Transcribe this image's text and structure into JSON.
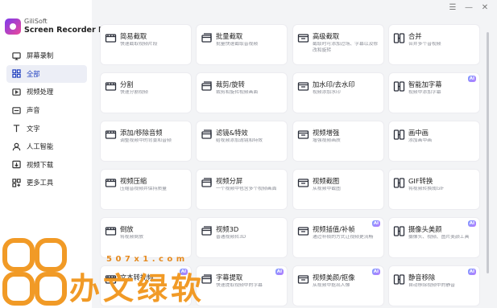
{
  "brand": {
    "line1": "GiliSoft",
    "line2": "Screen Recorder Pro"
  },
  "window_controls": [
    "☰",
    "—",
    "✕"
  ],
  "sidebar": {
    "items": [
      {
        "label": "屏幕录制",
        "icon": "monitor-icon"
      },
      {
        "label": "全部",
        "icon": "grid-icon",
        "active": true
      },
      {
        "label": "视频处理",
        "icon": "video-icon"
      },
      {
        "label": "声音",
        "icon": "speaker-icon"
      },
      {
        "label": "文字",
        "icon": "text-icon"
      },
      {
        "label": "人工智能",
        "icon": "ai-person-icon"
      },
      {
        "label": "视频下载",
        "icon": "download-icon"
      },
      {
        "label": "更多工具",
        "icon": "tools-icon"
      }
    ]
  },
  "cards": [
    {
      "title": "简易截取",
      "desc": "快速截取视频片段",
      "icon": "film-cut-icon"
    },
    {
      "title": "批量截取",
      "desc": "批量快速截取音视频",
      "icon": "film-batch-icon"
    },
    {
      "title": "高级截取",
      "desc": "截取时可添加过场、字幕以及修改和旋转",
      "icon": "film-advanced-icon"
    },
    {
      "title": "合并",
      "desc": "合并多个音视频",
      "icon": "merge-icon"
    },
    {
      "title": "分割",
      "desc": "快速分割视频",
      "icon": "split-icon"
    },
    {
      "title": "裁剪/旋转",
      "desc": "裁剪和旋转视频画面",
      "icon": "crop-icon"
    },
    {
      "title": "加水印/去水印",
      "desc": "视频添加水印",
      "icon": "watermark-icon"
    },
    {
      "title": "智能加字幕",
      "desc": "视频中添加字幕",
      "icon": "subtitle-ai-icon",
      "ai": true
    },
    {
      "title": "添加/移除音频",
      "desc": "调整视频中的背景和音频",
      "icon": "audio-icon"
    },
    {
      "title": "滤镜&特效",
      "desc": "给视频添加滤镜和特效",
      "icon": "filter-icon"
    },
    {
      "title": "视频增强",
      "desc": "增强视频画质",
      "icon": "enhance-icon"
    },
    {
      "title": "画中画",
      "desc": "添加画中画",
      "icon": "pip-icon"
    },
    {
      "title": "视频压缩",
      "desc": "压缩音视频并保持质量",
      "icon": "compress-icon"
    },
    {
      "title": "视频分屏",
      "desc": "一个视频中包含多个视频画面",
      "icon": "splitscreen-icon"
    },
    {
      "title": "视频截图",
      "desc": "从视频中截图",
      "icon": "screenshot-icon"
    },
    {
      "title": "GIF转换",
      "desc": "将视频转换成GIF",
      "icon": "gif-icon"
    },
    {
      "title": "倒放",
      "desc": "将视频倒放",
      "icon": "reverse-icon"
    },
    {
      "title": "视频3D",
      "desc": "普通视频转3D",
      "icon": "3d-icon"
    },
    {
      "title": "视频插值/补帧",
      "desc": "通过补帧的方式让视频更流畅",
      "icon": "interpolate-icon",
      "ai": true
    },
    {
      "title": "摄像头美颜",
      "desc": "摄像头、视频、图片美颜工具",
      "icon": "beauty-cam-icon",
      "ai": true
    },
    {
      "title": "文本转视频",
      "desc": "",
      "icon": "text-video-icon",
      "ai": true
    },
    {
      "title": "字幕提取",
      "desc": "快速提取视频中的字幕",
      "icon": "subtitle-extract-icon",
      "ai": true
    },
    {
      "title": "视频美颜/抠像",
      "desc": "从视频中抠出人像",
      "icon": "matting-icon",
      "ai": true
    },
    {
      "title": "静音移除",
      "desc": "自动移除视频中的静音",
      "icon": "silence-icon",
      "ai": true
    }
  ],
  "watermark": {
    "text": "办文绿软",
    "url": "5 0 7 x 1 . c o m"
  }
}
